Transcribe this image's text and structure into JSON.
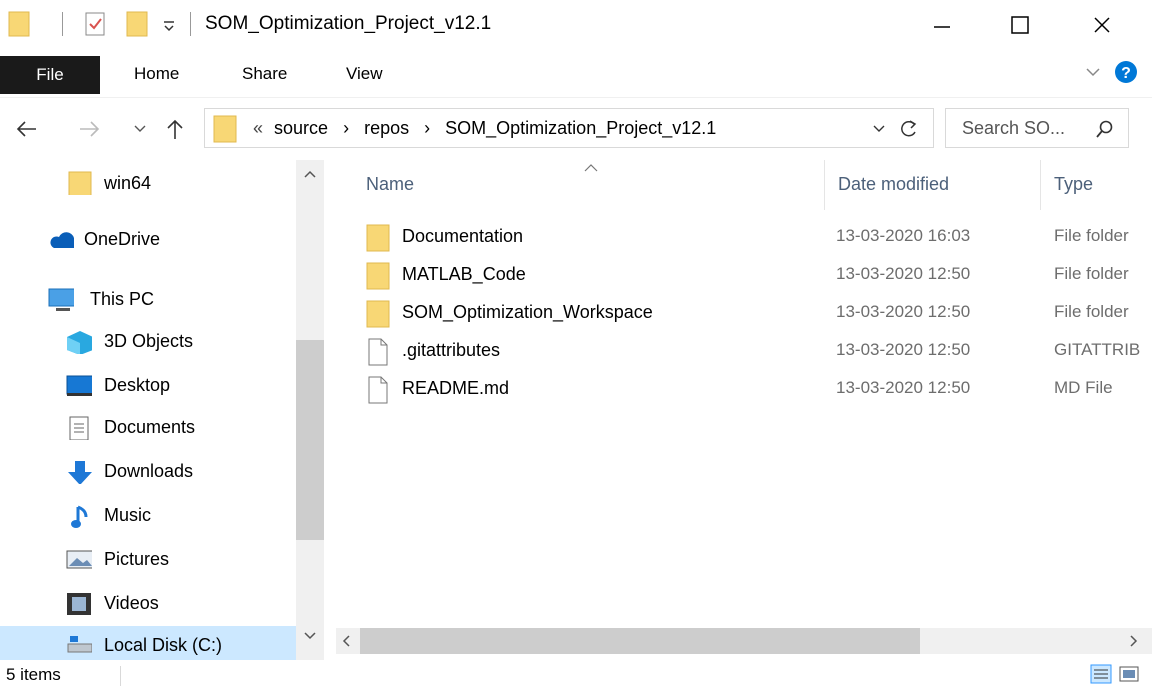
{
  "window": {
    "title": "SOM_Optimization_Project_v12.1",
    "minimize_glyph": "—",
    "maximize_glyph": "☐",
    "close_glyph": "✕"
  },
  "ribbon": {
    "tabs": [
      "File",
      "Home",
      "Share",
      "View"
    ]
  },
  "address": {
    "overflow": "«",
    "crumbs": [
      "source",
      "repos",
      "SOM_Optimization_Project_v12.1"
    ],
    "separator": "›",
    "search_placeholder": "Search SO..."
  },
  "nav": {
    "items": [
      {
        "label": "win64",
        "icon": "folder-icon"
      },
      {
        "label": "OneDrive",
        "icon": "onedrive-cloud-icon"
      },
      {
        "label": "This PC",
        "icon": "this-pc-monitor-icon"
      },
      {
        "label": "3D Objects",
        "icon": "3d-objects-icon"
      },
      {
        "label": "Desktop",
        "icon": "desktop-icon"
      },
      {
        "label": "Documents",
        "icon": "documents-icon"
      },
      {
        "label": "Downloads",
        "icon": "downloads-arrow-icon"
      },
      {
        "label": "Music",
        "icon": "music-note-icon"
      },
      {
        "label": "Pictures",
        "icon": "pictures-icon"
      },
      {
        "label": "Videos",
        "icon": "videos-icon"
      },
      {
        "label": "Local Disk (C:)",
        "icon": "local-disk-icon"
      }
    ]
  },
  "content": {
    "headers": {
      "name": "Name",
      "date": "Date modified",
      "type": "Type"
    },
    "files": [
      {
        "name": "Documentation",
        "date": "13-03-2020 16:03",
        "type": "File folder",
        "kind": "folder"
      },
      {
        "name": "MATLAB_Code",
        "date": "13-03-2020 12:50",
        "type": "File folder",
        "kind": "folder"
      },
      {
        "name": "SOM_Optimization_Workspace",
        "date": "13-03-2020 12:50",
        "type": "File folder",
        "kind": "folder"
      },
      {
        "name": ".gitattributes",
        "date": "13-03-2020 12:50",
        "type": "GITATTRIB",
        "kind": "file"
      },
      {
        "name": "README.md",
        "date": "13-03-2020 12:50",
        "type": "MD File",
        "kind": "file"
      }
    ]
  },
  "status": {
    "count": "5 items"
  },
  "colors": {
    "folder": "#f8d775",
    "accent": "#0078d7",
    "selection": "#cce8ff"
  }
}
